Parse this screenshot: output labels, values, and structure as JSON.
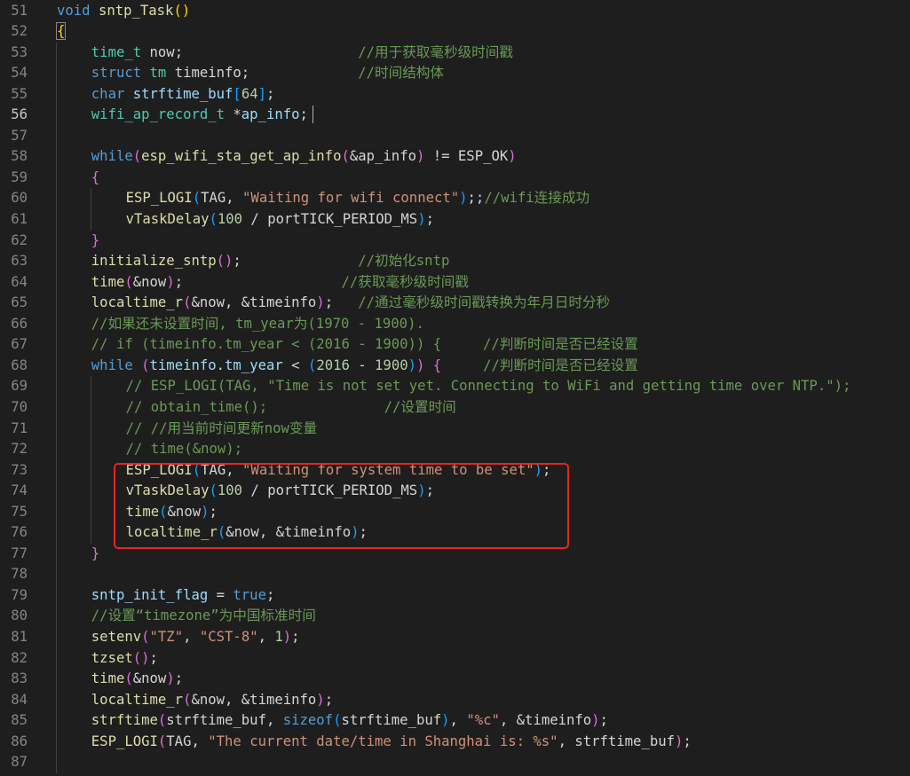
{
  "editor": {
    "active_line": 56,
    "lines": [
      {
        "n": 51,
        "indent": 0,
        "tokens": [
          [
            "keyword",
            "void"
          ],
          [
            "plain",
            " "
          ],
          [
            "func",
            "sntp_Task"
          ],
          [
            "brace",
            "()"
          ]
        ]
      },
      {
        "n": 52,
        "indent": 0,
        "tokens": [
          [
            "brace-hl",
            "{"
          ]
        ]
      },
      {
        "n": 53,
        "indent": 1,
        "tokens": [
          [
            "type",
            "time_t"
          ],
          [
            "plain",
            " now;                     "
          ],
          [
            "comment",
            "//用于获取毫秒级时间戳"
          ]
        ]
      },
      {
        "n": 54,
        "indent": 1,
        "tokens": [
          [
            "keyword",
            "struct"
          ],
          [
            "plain",
            " "
          ],
          [
            "type",
            "tm"
          ],
          [
            "plain",
            " timeinfo;             "
          ],
          [
            "comment",
            "//时间结构体"
          ]
        ]
      },
      {
        "n": 55,
        "indent": 1,
        "tokens": [
          [
            "keyword",
            "char"
          ],
          [
            "plain",
            " "
          ],
          [
            "var",
            "strftime_buf"
          ],
          [
            "bracket",
            "["
          ],
          [
            "number",
            "64"
          ],
          [
            "bracket",
            "]"
          ],
          [
            "plain",
            ";"
          ]
        ]
      },
      {
        "n": 56,
        "indent": 1,
        "tokens": [
          [
            "type",
            "wifi_ap_record_t"
          ],
          [
            "plain",
            " *"
          ],
          [
            "var",
            "ap_info"
          ],
          [
            "plain",
            ";"
          ]
        ]
      },
      {
        "n": 57,
        "indent": 0,
        "tokens": []
      },
      {
        "n": 58,
        "indent": 1,
        "tokens": [
          [
            "keyword",
            "while"
          ],
          [
            "paren",
            "("
          ],
          [
            "func",
            "esp_wifi_sta_get_ap_info"
          ],
          [
            "paren",
            "("
          ],
          [
            "plain",
            "&ap_info"
          ],
          [
            "paren",
            ")"
          ],
          [
            "plain",
            " != ESP_OK"
          ],
          [
            "paren",
            ")"
          ]
        ]
      },
      {
        "n": 59,
        "indent": 1,
        "tokens": [
          [
            "paren",
            "{"
          ]
        ]
      },
      {
        "n": 60,
        "indent": 2,
        "tokens": [
          [
            "func",
            "ESP_LOGI"
          ],
          [
            "bracket",
            "("
          ],
          [
            "plain",
            "TAG, "
          ],
          [
            "string",
            "\"Waiting for wifi connect\""
          ],
          [
            "bracket",
            ")"
          ],
          [
            "plain",
            ";;"
          ],
          [
            "comment",
            "//wifi连接成功"
          ]
        ]
      },
      {
        "n": 61,
        "indent": 2,
        "tokens": [
          [
            "func",
            "vTaskDelay"
          ],
          [
            "bracket",
            "("
          ],
          [
            "number",
            "100"
          ],
          [
            "plain",
            " / portTICK_PERIOD_MS"
          ],
          [
            "bracket",
            ")"
          ],
          [
            "plain",
            ";"
          ]
        ]
      },
      {
        "n": 62,
        "indent": 1,
        "tokens": [
          [
            "paren",
            "}"
          ]
        ]
      },
      {
        "n": 63,
        "indent": 1,
        "tokens": [
          [
            "func",
            "initialize_sntp"
          ],
          [
            "paren",
            "()"
          ],
          [
            "plain",
            ";              "
          ],
          [
            "comment",
            "//初始化sntp"
          ]
        ]
      },
      {
        "n": 64,
        "indent": 1,
        "tokens": [
          [
            "func",
            "time"
          ],
          [
            "paren",
            "("
          ],
          [
            "plain",
            "&now"
          ],
          [
            "paren",
            ")"
          ],
          [
            "plain",
            ";                   "
          ],
          [
            "comment",
            "//获取毫秒级时间戳"
          ]
        ]
      },
      {
        "n": 65,
        "indent": 1,
        "tokens": [
          [
            "func",
            "localtime_r"
          ],
          [
            "paren",
            "("
          ],
          [
            "plain",
            "&now, &timeinfo"
          ],
          [
            "paren",
            ")"
          ],
          [
            "plain",
            ";   "
          ],
          [
            "comment",
            "//通过毫秒级时间戳转换为年月日时分秒"
          ]
        ]
      },
      {
        "n": 66,
        "indent": 1,
        "tokens": [
          [
            "comment",
            "//如果还未设置时间, tm_year为(1970 - 1900)."
          ]
        ]
      },
      {
        "n": 67,
        "indent": 1,
        "tokens": [
          [
            "comment",
            "// if (timeinfo.tm_year < (2016 - 1900)) {     //判断时间是否已经设置"
          ]
        ]
      },
      {
        "n": 68,
        "indent": 1,
        "tokens": [
          [
            "keyword",
            "while"
          ],
          [
            "plain",
            " "
          ],
          [
            "paren",
            "("
          ],
          [
            "var",
            "timeinfo"
          ],
          [
            "plain",
            "."
          ],
          [
            "var",
            "tm_year"
          ],
          [
            "plain",
            " < "
          ],
          [
            "bracket",
            "("
          ],
          [
            "number",
            "2016"
          ],
          [
            "plain",
            " - "
          ],
          [
            "number",
            "1900"
          ],
          [
            "bracket",
            ")"
          ],
          [
            "paren",
            ")"
          ],
          [
            "plain",
            " "
          ],
          [
            "paren",
            "{"
          ],
          [
            "plain",
            "     "
          ],
          [
            "comment",
            "//判断时间是否已经设置"
          ]
        ]
      },
      {
        "n": 69,
        "indent": 2,
        "tokens": [
          [
            "comment",
            "// ESP_LOGI(TAG, \"Time is not set yet. Connecting to WiFi and getting time over NTP.\");"
          ]
        ]
      },
      {
        "n": 70,
        "indent": 2,
        "tokens": [
          [
            "comment",
            "// obtain_time();              //设置时间"
          ]
        ]
      },
      {
        "n": 71,
        "indent": 2,
        "tokens": [
          [
            "comment",
            "// //用当前时间更新now变量"
          ]
        ]
      },
      {
        "n": 72,
        "indent": 2,
        "tokens": [
          [
            "comment",
            "// time(&now);"
          ]
        ]
      },
      {
        "n": 73,
        "indent": 2,
        "tokens": [
          [
            "func",
            "ESP_LOGI"
          ],
          [
            "bracket",
            "("
          ],
          [
            "plain",
            "TAG, "
          ],
          [
            "string",
            "\"Waiting for system time to be set\""
          ],
          [
            "bracket",
            ")"
          ],
          [
            "plain",
            ";"
          ]
        ]
      },
      {
        "n": 74,
        "indent": 2,
        "tokens": [
          [
            "func",
            "vTaskDelay"
          ],
          [
            "bracket",
            "("
          ],
          [
            "number",
            "100"
          ],
          [
            "plain",
            " / portTICK_PERIOD_MS"
          ],
          [
            "bracket",
            ")"
          ],
          [
            "plain",
            ";"
          ]
        ]
      },
      {
        "n": 75,
        "indent": 2,
        "tokens": [
          [
            "func",
            "time"
          ],
          [
            "bracket",
            "("
          ],
          [
            "plain",
            "&now"
          ],
          [
            "bracket",
            ")"
          ],
          [
            "plain",
            ";"
          ]
        ]
      },
      {
        "n": 76,
        "indent": 2,
        "tokens": [
          [
            "func",
            "localtime_r"
          ],
          [
            "bracket",
            "("
          ],
          [
            "plain",
            "&now, &timeinfo"
          ],
          [
            "bracket",
            ")"
          ],
          [
            "plain",
            ";"
          ]
        ]
      },
      {
        "n": 77,
        "indent": 1,
        "tokens": [
          [
            "paren",
            "}"
          ]
        ]
      },
      {
        "n": 78,
        "indent": 0,
        "tokens": []
      },
      {
        "n": 79,
        "indent": 1,
        "tokens": [
          [
            "var",
            "sntp_init_flag"
          ],
          [
            "plain",
            " = "
          ],
          [
            "keyword",
            "true"
          ],
          [
            "plain",
            ";"
          ]
        ]
      },
      {
        "n": 80,
        "indent": 1,
        "tokens": [
          [
            "comment",
            "//设置“timezone”为中国标准时间"
          ]
        ]
      },
      {
        "n": 81,
        "indent": 1,
        "tokens": [
          [
            "func",
            "setenv"
          ],
          [
            "paren",
            "("
          ],
          [
            "string",
            "\"TZ\""
          ],
          [
            "plain",
            ", "
          ],
          [
            "string",
            "\"CST-8\""
          ],
          [
            "plain",
            ", "
          ],
          [
            "number",
            "1"
          ],
          [
            "paren",
            ")"
          ],
          [
            "plain",
            ";"
          ]
        ]
      },
      {
        "n": 82,
        "indent": 1,
        "tokens": [
          [
            "func",
            "tzset"
          ],
          [
            "paren",
            "()"
          ],
          [
            "plain",
            ";"
          ]
        ]
      },
      {
        "n": 83,
        "indent": 1,
        "tokens": [
          [
            "func",
            "time"
          ],
          [
            "paren",
            "("
          ],
          [
            "plain",
            "&now"
          ],
          [
            "paren",
            ")"
          ],
          [
            "plain",
            ";"
          ]
        ]
      },
      {
        "n": 84,
        "indent": 1,
        "tokens": [
          [
            "func",
            "localtime_r"
          ],
          [
            "paren",
            "("
          ],
          [
            "plain",
            "&now, &timeinfo"
          ],
          [
            "paren",
            ")"
          ],
          [
            "plain",
            ";"
          ]
        ]
      },
      {
        "n": 85,
        "indent": 1,
        "tokens": [
          [
            "func",
            "strftime"
          ],
          [
            "paren",
            "("
          ],
          [
            "plain",
            "strftime_buf, "
          ],
          [
            "keyword",
            "sizeof"
          ],
          [
            "bracket",
            "("
          ],
          [
            "plain",
            "strftime_buf"
          ],
          [
            "bracket",
            ")"
          ],
          [
            "plain",
            ", "
          ],
          [
            "string",
            "\"%c\""
          ],
          [
            "plain",
            ", &timeinfo"
          ],
          [
            "paren",
            ")"
          ],
          [
            "plain",
            ";"
          ]
        ]
      },
      {
        "n": 86,
        "indent": 1,
        "tokens": [
          [
            "func",
            "ESP_LOGI"
          ],
          [
            "paren",
            "("
          ],
          [
            "plain",
            "TAG, "
          ],
          [
            "string",
            "\"The current date/time in Shanghai is: %s\""
          ],
          [
            "plain",
            ", strftime_buf"
          ],
          [
            "paren",
            ")"
          ],
          [
            "plain",
            ";"
          ]
        ]
      },
      {
        "n": 87,
        "indent": 0,
        "tokens": []
      }
    ]
  }
}
